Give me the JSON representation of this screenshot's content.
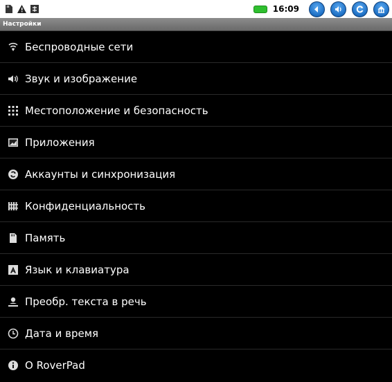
{
  "status": {
    "time": "16:09",
    "left_icons": [
      "sd-card-icon",
      "warning-icon",
      "usb-debug-icon"
    ],
    "right_buttons": [
      "back-button",
      "volume-button",
      "refresh-button",
      "home-button"
    ],
    "battery_color": "#2fbf2f"
  },
  "header": {
    "title": "Настройки"
  },
  "items": [
    {
      "label": "Беспроводные сети",
      "icon": "wifi-icon"
    },
    {
      "label": "Звук и изображение",
      "icon": "speaker-icon"
    },
    {
      "label": "Местоположение и безопасность",
      "icon": "location-grid-icon"
    },
    {
      "label": "Приложения",
      "icon": "applications-icon"
    },
    {
      "label": "Аккаунты и синхронизация",
      "icon": "sync-icon"
    },
    {
      "label": "Конфиденциальность",
      "icon": "privacy-icon"
    },
    {
      "label": "Память",
      "icon": "memory-card-icon"
    },
    {
      "label": "Язык и клавиатура",
      "icon": "keyboard-icon"
    },
    {
      "label": "Преобр. текста в речь",
      "icon": "text-to-speech-icon"
    },
    {
      "label": "Дата и время",
      "icon": "clock-icon"
    },
    {
      "label": "О RoverPad",
      "icon": "info-icon"
    }
  ]
}
